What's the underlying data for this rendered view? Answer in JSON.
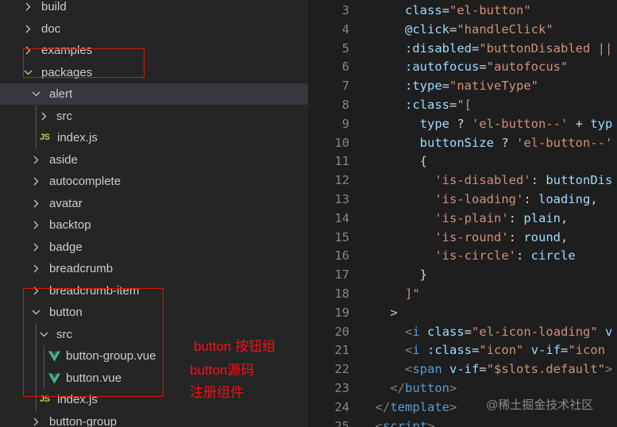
{
  "explorer": {
    "items": [
      {
        "label": "build",
        "depth": 0,
        "kind": "folder",
        "open": false,
        "selected": false
      },
      {
        "label": "doc",
        "depth": 0,
        "kind": "folder",
        "open": false,
        "selected": false
      },
      {
        "label": "examples",
        "depth": 0,
        "kind": "folder",
        "open": false,
        "selected": false
      },
      {
        "label": "packages",
        "depth": 0,
        "kind": "folder",
        "open": true,
        "selected": false
      },
      {
        "label": "alert",
        "depth": 1,
        "kind": "folder",
        "open": true,
        "selected": true
      },
      {
        "label": "src",
        "depth": 2,
        "kind": "folder",
        "open": false,
        "selected": false
      },
      {
        "label": "index.js",
        "depth": 2,
        "kind": "js",
        "selected": false
      },
      {
        "label": "aside",
        "depth": 1,
        "kind": "folder",
        "open": false,
        "selected": false
      },
      {
        "label": "autocomplete",
        "depth": 1,
        "kind": "folder",
        "open": false,
        "selected": false
      },
      {
        "label": "avatar",
        "depth": 1,
        "kind": "folder",
        "open": false,
        "selected": false
      },
      {
        "label": "backtop",
        "depth": 1,
        "kind": "folder",
        "open": false,
        "selected": false
      },
      {
        "label": "badge",
        "depth": 1,
        "kind": "folder",
        "open": false,
        "selected": false
      },
      {
        "label": "breadcrumb",
        "depth": 1,
        "kind": "folder",
        "open": false,
        "selected": false
      },
      {
        "label": "breadcrumb-item",
        "depth": 1,
        "kind": "folder",
        "open": false,
        "selected": false
      },
      {
        "label": "button",
        "depth": 1,
        "kind": "folder",
        "open": true,
        "selected": false
      },
      {
        "label": "src",
        "depth": 2,
        "kind": "folder",
        "open": true,
        "selected": false
      },
      {
        "label": "button-group.vue",
        "depth": 3,
        "kind": "vue",
        "selected": false
      },
      {
        "label": "button.vue",
        "depth": 3,
        "kind": "vue",
        "selected": false
      },
      {
        "label": "index.js",
        "depth": 2,
        "kind": "js",
        "selected": false
      },
      {
        "label": "button-group",
        "depth": 1,
        "kind": "folder",
        "open": false,
        "selected": false
      }
    ],
    "js_badge": "JS"
  },
  "annotations": [
    {
      "text": "button 按钮组"
    },
    {
      "text": "button源码"
    },
    {
      "text": "注册组件"
    }
  ],
  "editor": {
    "lines": [
      {
        "n": "3",
        "indent": 6,
        "tokens": [
          [
            "attr",
            "class"
          ],
          [
            "plain",
            "="
          ],
          [
            "str",
            "\"el-button\""
          ]
        ]
      },
      {
        "n": "4",
        "indent": 6,
        "tokens": [
          [
            "attr",
            "@click"
          ],
          [
            "plain",
            "="
          ],
          [
            "str",
            "\"handleClick\""
          ]
        ]
      },
      {
        "n": "5",
        "indent": 6,
        "tokens": [
          [
            "attr",
            ":disabled"
          ],
          [
            "plain",
            "="
          ],
          [
            "str",
            "\"buttonDisabled ||"
          ]
        ]
      },
      {
        "n": "6",
        "indent": 6,
        "tokens": [
          [
            "attr",
            ":autofocus"
          ],
          [
            "plain",
            "="
          ],
          [
            "str",
            "\"autofocus\""
          ]
        ]
      },
      {
        "n": "7",
        "indent": 6,
        "tokens": [
          [
            "attr",
            ":type"
          ],
          [
            "plain",
            "="
          ],
          [
            "str",
            "\"nativeType\""
          ]
        ]
      },
      {
        "n": "8",
        "indent": 6,
        "tokens": [
          [
            "attr",
            ":class"
          ],
          [
            "plain",
            "="
          ],
          [
            "str",
            "\"["
          ]
        ]
      },
      {
        "n": "9",
        "indent": 8,
        "tokens": [
          [
            "attr",
            "type"
          ],
          [
            "plain",
            " ? "
          ],
          [
            "str",
            "'el-button--'"
          ],
          [
            "plain",
            " + "
          ],
          [
            "attr",
            "typ"
          ]
        ]
      },
      {
        "n": "10",
        "indent": 8,
        "tokens": [
          [
            "attr",
            "buttonSize"
          ],
          [
            "plain",
            " ? "
          ],
          [
            "str",
            "'el-button--'"
          ]
        ]
      },
      {
        "n": "11",
        "indent": 8,
        "tokens": [
          [
            "plain",
            "{"
          ]
        ]
      },
      {
        "n": "12",
        "indent": 10,
        "tokens": [
          [
            "str",
            "'is-disabled'"
          ],
          [
            "plain",
            ": "
          ],
          [
            "attr",
            "buttonDis"
          ]
        ]
      },
      {
        "n": "13",
        "indent": 10,
        "tokens": [
          [
            "str",
            "'is-loading'"
          ],
          [
            "plain",
            ": "
          ],
          [
            "attr",
            "loading"
          ],
          [
            "plain",
            ","
          ]
        ]
      },
      {
        "n": "14",
        "indent": 10,
        "tokens": [
          [
            "str",
            "'is-plain'"
          ],
          [
            "plain",
            ": "
          ],
          [
            "attr",
            "plain"
          ],
          [
            "plain",
            ","
          ]
        ]
      },
      {
        "n": "15",
        "indent": 10,
        "tokens": [
          [
            "str",
            "'is-round'"
          ],
          [
            "plain",
            ": "
          ],
          [
            "attr",
            "round"
          ],
          [
            "plain",
            ","
          ]
        ]
      },
      {
        "n": "16",
        "indent": 10,
        "tokens": [
          [
            "str",
            "'is-circle'"
          ],
          [
            "plain",
            ": "
          ],
          [
            "attr",
            "circle"
          ]
        ]
      },
      {
        "n": "17",
        "indent": 8,
        "tokens": [
          [
            "plain",
            "}"
          ]
        ]
      },
      {
        "n": "18",
        "indent": 6,
        "tokens": [
          [
            "str",
            "]\""
          ]
        ]
      },
      {
        "n": "19",
        "indent": 4,
        "tokens": [
          [
            "fold",
            ">"
          ]
        ]
      },
      {
        "n": "20",
        "indent": 6,
        "tokens": [
          [
            "punc",
            "<"
          ],
          [
            "tag",
            "i"
          ],
          [
            "plain",
            " "
          ],
          [
            "attr",
            "class"
          ],
          [
            "plain",
            "="
          ],
          [
            "str",
            "\"el-icon-loading\""
          ],
          [
            "plain",
            " "
          ],
          [
            "attr",
            "v"
          ]
        ]
      },
      {
        "n": "21",
        "indent": 6,
        "tokens": [
          [
            "punc",
            "<"
          ],
          [
            "tag",
            "i"
          ],
          [
            "plain",
            " "
          ],
          [
            "attr",
            ":class"
          ],
          [
            "plain",
            "="
          ],
          [
            "str",
            "\"icon\""
          ],
          [
            "plain",
            " "
          ],
          [
            "attr",
            "v-if"
          ],
          [
            "plain",
            "="
          ],
          [
            "str",
            "\"icon"
          ]
        ]
      },
      {
        "n": "22",
        "indent": 6,
        "tokens": [
          [
            "punc",
            "<"
          ],
          [
            "tag",
            "span"
          ],
          [
            "plain",
            " "
          ],
          [
            "attr",
            "v-if"
          ],
          [
            "plain",
            "="
          ],
          [
            "str",
            "\"$slots.default\""
          ],
          [
            "punc",
            ">"
          ]
        ]
      },
      {
        "n": "23",
        "indent": 4,
        "tokens": [
          [
            "punc",
            "</"
          ],
          [
            "tag",
            "button"
          ],
          [
            "punc",
            ">"
          ]
        ]
      },
      {
        "n": "24",
        "indent": 2,
        "tokens": [
          [
            "punc",
            "</"
          ],
          [
            "tag",
            "template"
          ],
          [
            "punc",
            ">"
          ]
        ]
      },
      {
        "n": "25",
        "indent": 2,
        "tokens": [
          [
            "punc",
            "<"
          ],
          [
            "tag",
            "script"
          ],
          [
            "punc",
            ">"
          ]
        ]
      }
    ]
  },
  "watermark": "@稀土掘金技术社区",
  "colors": {
    "annotation_red": "#e51400",
    "selection": "#37373d",
    "vue_green": "#41b883",
    "js_yellow": "#cbcb41"
  }
}
